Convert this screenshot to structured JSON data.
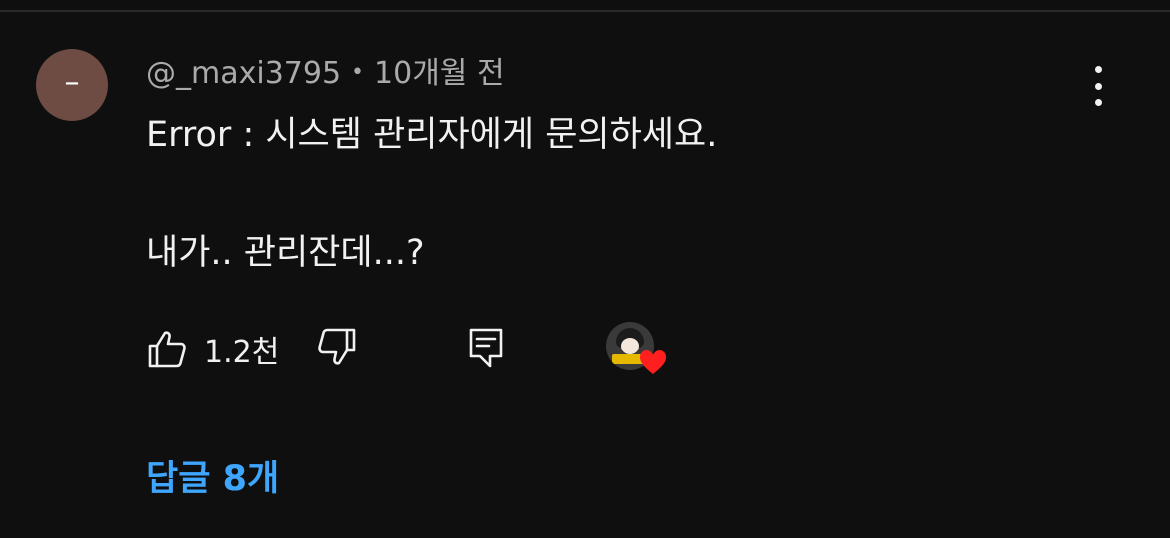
{
  "comment": {
    "avatar_letter": "–",
    "author": "@_maxi3795",
    "separator": "•",
    "time": "10개월 전",
    "lines": [
      "Error : 시스템 관리자에게 문의하세요.",
      "내가.. 관리잔데...?"
    ],
    "like_count": "1.2천",
    "replies_label": "답글 8개"
  },
  "icons": {
    "more": "more-vertical-icon",
    "like": "thumbs-up-icon",
    "dislike": "thumbs-down-icon",
    "reply": "reply-comment-icon",
    "heart": "heart-icon"
  },
  "colors": {
    "background": "#0f0f0f",
    "avatar": "#6e4c43",
    "replies_link": "#3ea6ff",
    "heart": "#ff1f1f"
  }
}
